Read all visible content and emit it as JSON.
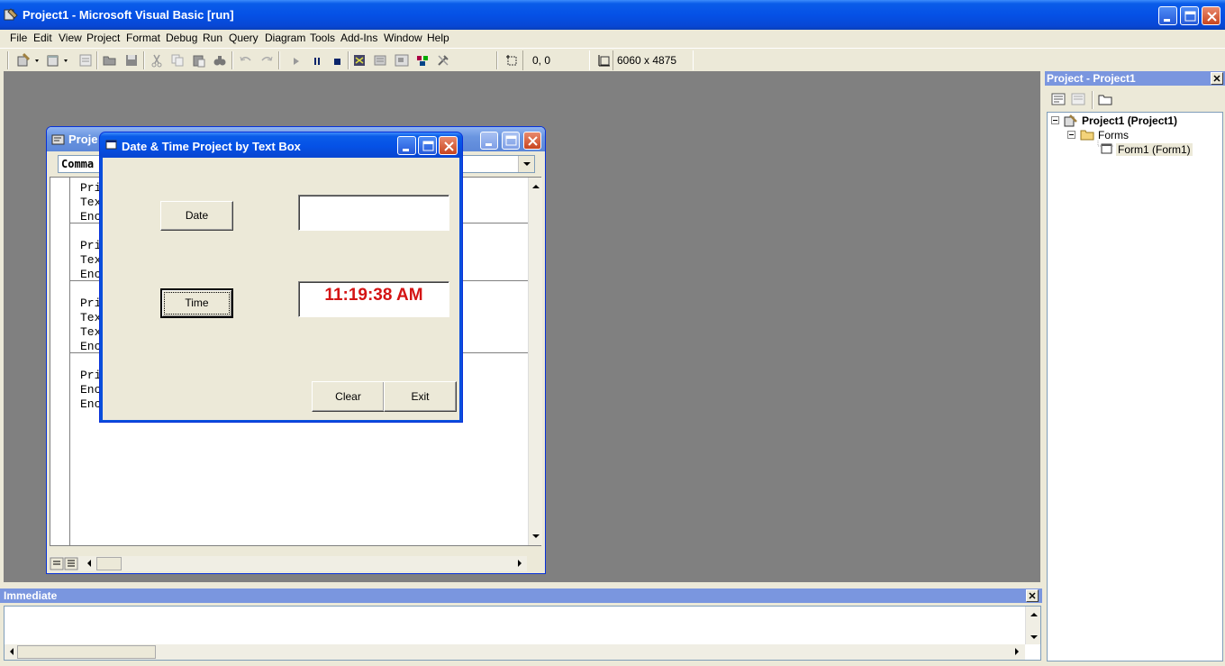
{
  "app": {
    "title": "Project1 - Microsoft Visual Basic [run]"
  },
  "menu": [
    "File",
    "Edit",
    "View",
    "Project",
    "Format",
    "Debug",
    "Run",
    "Query",
    "Diagram",
    "Tools",
    "Add-Ins",
    "Window",
    "Help"
  ],
  "toolbar": {
    "position": "0, 0",
    "size": "6060 x 4875"
  },
  "code_window": {
    "title": "Proje",
    "object_combo": "Comma",
    "lines": [
      [
        "Pri",
        "Tex",
        "Enc"
      ],
      [
        "Pri",
        "Tex",
        "Enc"
      ],
      [
        "Pri",
        "Tex",
        "Tex",
        "Enc"
      ],
      [
        "Pri",
        "Enc",
        "Enc"
      ]
    ]
  },
  "form": {
    "title": "Date & Time Project by Text Box",
    "date_button": "Date",
    "time_button": "Time",
    "date_value": "",
    "time_value": "11:19:38 AM",
    "clear_button": "Clear",
    "exit_button": "Exit",
    "time_color": "#d41414"
  },
  "project_explorer": {
    "title": "Project - Project1",
    "root": "Project1 (Project1)",
    "folder": "Forms",
    "item": "Form1 (Form1)"
  },
  "immediate": {
    "title": "Immediate",
    "content": ""
  }
}
